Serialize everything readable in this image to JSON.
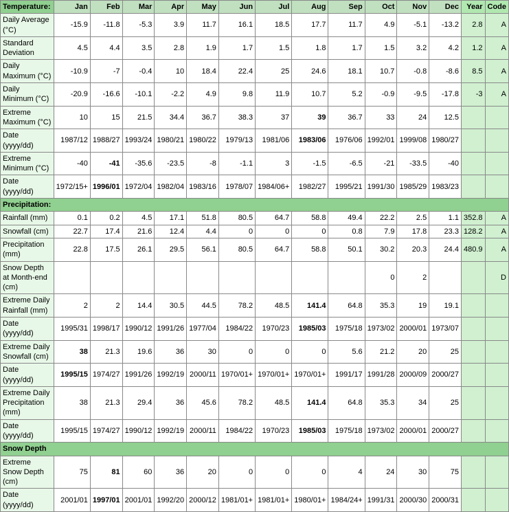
{
  "table": {
    "headers": [
      "Temperature:",
      "Jan",
      "Feb",
      "Mar",
      "Apr",
      "May",
      "Jun",
      "Jul",
      "Aug",
      "Sep",
      "Oct",
      "Nov",
      "Dec",
      "Year",
      "Code"
    ],
    "rows": [
      {
        "label": "Daily Average (°C)",
        "values": [
          "-15.9",
          "-11.8",
          "-5.3",
          "3.9",
          "11.7",
          "16.1",
          "18.5",
          "17.7",
          "11.7",
          "4.9",
          "-5.1",
          "-13.2",
          "2.8",
          "A"
        ],
        "bold_indices": []
      },
      {
        "label": "Standard Deviation",
        "values": [
          "4.5",
          "4.4",
          "3.5",
          "2.8",
          "1.9",
          "1.7",
          "1.5",
          "1.8",
          "1.7",
          "1.5",
          "3.2",
          "4.2",
          "1.2",
          "A"
        ],
        "bold_indices": []
      },
      {
        "label": "Daily Maximum (°C)",
        "values": [
          "-10.9",
          "-7",
          "-0.4",
          "10",
          "18.4",
          "22.4",
          "25",
          "24.6",
          "18.1",
          "10.7",
          "-0.8",
          "-8.6",
          "8.5",
          "A"
        ],
        "bold_indices": []
      },
      {
        "label": "Daily Minimum (°C)",
        "values": [
          "-20.9",
          "-16.6",
          "-10.1",
          "-2.2",
          "4.9",
          "9.8",
          "11.9",
          "10.7",
          "5.2",
          "-0.9",
          "-9.5",
          "-17.8",
          "-3",
          "A"
        ],
        "bold_indices": []
      },
      {
        "label": "Extreme Maximum (°C)",
        "values": [
          "10",
          "15",
          "21.5",
          "34.4",
          "36.7",
          "38.3",
          "37",
          "39",
          "36.7",
          "33",
          "24",
          "12.5",
          "",
          ""
        ],
        "bold_indices": [
          7
        ]
      },
      {
        "label": "Date (yyyy/dd)",
        "values": [
          "1987/12",
          "1988/27",
          "1993/24",
          "1980/21",
          "1980/22",
          "1979/13",
          "1981/06",
          "1983/06",
          "1976/06",
          "1992/01",
          "1999/08",
          "1980/27",
          "",
          ""
        ],
        "bold_indices": [
          7
        ]
      },
      {
        "label": "Extreme Minimum (°C)",
        "values": [
          "-40",
          "-41",
          "-35.6",
          "-23.5",
          "-8",
          "-1.1",
          "3",
          "-1.5",
          "-6.5",
          "-21",
          "-33.5",
          "-40",
          "",
          ""
        ],
        "bold_indices": [
          1
        ]
      },
      {
        "label": "Date (yyyy/dd)",
        "values": [
          "1972/15+",
          "1996/01",
          "1972/04",
          "1982/04",
          "1983/16",
          "1978/07",
          "1984/06+",
          "1982/27",
          "1995/21",
          "1991/30",
          "1985/29",
          "1983/23",
          "",
          ""
        ],
        "bold_indices": [
          1
        ]
      },
      {
        "section": "Precipitation:"
      },
      {
        "label": "Rainfall (mm)",
        "values": [
          "0.1",
          "0.2",
          "4.5",
          "17.1",
          "51.8",
          "80.5",
          "64.7",
          "58.8",
          "49.4",
          "22.2",
          "2.5",
          "1.1",
          "352.8",
          "A"
        ],
        "bold_indices": []
      },
      {
        "label": "Snowfall (cm)",
        "values": [
          "22.7",
          "17.4",
          "21.6",
          "12.4",
          "4.4",
          "0",
          "0",
          "0",
          "0.8",
          "7.9",
          "17.8",
          "23.3",
          "128.2",
          "A"
        ],
        "bold_indices": []
      },
      {
        "label": "Precipitation (mm)",
        "values": [
          "22.8",
          "17.5",
          "26.1",
          "29.5",
          "56.1",
          "80.5",
          "64.7",
          "58.8",
          "50.1",
          "30.2",
          "20.3",
          "24.4",
          "480.9",
          "A"
        ],
        "bold_indices": []
      },
      {
        "label": "Snow Depth at Month-end (cm)",
        "values": [
          "",
          "",
          "",
          "",
          "",
          "",
          "",
          "",
          "",
          "0",
          "2",
          "",
          "",
          "D"
        ],
        "bold_indices": []
      },
      {
        "label": "Extreme Daily Rainfall (mm)",
        "values": [
          "2",
          "2",
          "14.4",
          "30.5",
          "44.5",
          "78.2",
          "48.5",
          "141.4",
          "64.8",
          "35.3",
          "19",
          "19.1",
          "",
          ""
        ],
        "bold_indices": [
          7
        ]
      },
      {
        "label": "Date (yyyy/dd)",
        "values": [
          "1995/31",
          "1998/17",
          "1990/12",
          "1991/26",
          "1977/04",
          "1984/22",
          "1970/23",
          "1985/03",
          "1975/18",
          "1973/02",
          "2000/01",
          "1973/07",
          "",
          ""
        ],
        "bold_indices": [
          7
        ]
      },
      {
        "label": "Extreme Daily Snowfall (cm)",
        "values": [
          "38",
          "21.3",
          "19.6",
          "36",
          "30",
          "0",
          "0",
          "0",
          "5.6",
          "21.2",
          "20",
          "25",
          "",
          ""
        ],
        "bold_indices": [
          0
        ]
      },
      {
        "label": "Date (yyyy/dd)",
        "values": [
          "1995/15",
          "1974/27",
          "1991/26",
          "1992/19",
          "2000/11",
          "1970/01+",
          "1970/01+",
          "1970/01+",
          "1991/17",
          "1991/28",
          "2000/09",
          "2000/27",
          "",
          ""
        ],
        "bold_indices": [
          0
        ]
      },
      {
        "label": "Extreme Daily Precipitation (mm)",
        "values": [
          "38",
          "21.3",
          "29.4",
          "36",
          "45.6",
          "78.2",
          "48.5",
          "141.4",
          "64.8",
          "35.3",
          "34",
          "25",
          "",
          ""
        ],
        "bold_indices": [
          7
        ]
      },
      {
        "label": "Date (yyyy/dd)",
        "values": [
          "1995/15",
          "1974/27",
          "1990/12",
          "1992/19",
          "2000/11",
          "1984/22",
          "1970/23",
          "1985/03",
          "1975/18",
          "1973/02",
          "2000/01",
          "2000/27",
          "",
          ""
        ],
        "bold_indices": [
          7
        ]
      },
      {
        "section": "Snow Depth"
      },
      {
        "label": "Extreme Snow Depth (cm)",
        "values": [
          "75",
          "81",
          "60",
          "36",
          "20",
          "0",
          "0",
          "0",
          "4",
          "24",
          "30",
          "75",
          "",
          ""
        ],
        "bold_indices": [
          1
        ]
      },
      {
        "label": "Date (yyyy/dd)",
        "values": [
          "2001/01",
          "1997/01",
          "2001/01",
          "1992/20",
          "2000/12",
          "1981/01+",
          "1981/01+",
          "1980/01+",
          "1984/24+",
          "1991/31",
          "2000/30",
          "2000/31",
          "",
          ""
        ],
        "bold_indices": [
          1
        ]
      }
    ]
  }
}
